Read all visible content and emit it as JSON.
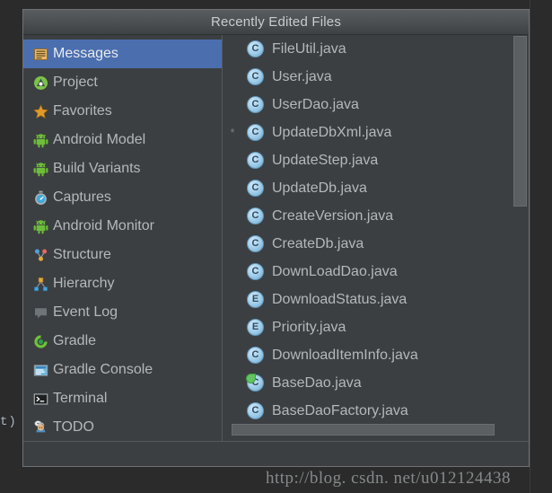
{
  "window": {
    "title": "Recently Edited Files"
  },
  "editor_peek": {
    "text": "t) ",
    "semicolon": ";"
  },
  "watermark": {
    "text": "http://blog. csdn. net/u012124438"
  },
  "sidebar": {
    "items": [
      {
        "label": "Messages",
        "icon": "messages-icon",
        "selected": true
      },
      {
        "label": "Project",
        "icon": "android-studio-icon",
        "selected": false
      },
      {
        "label": "Favorites",
        "icon": "star-icon",
        "selected": false
      },
      {
        "label": "Android Model",
        "icon": "android-robot-icon",
        "selected": false
      },
      {
        "label": "Build Variants",
        "icon": "android-robot-icon",
        "selected": false
      },
      {
        "label": "Captures",
        "icon": "stopwatch-icon",
        "selected": false
      },
      {
        "label": "Android Monitor",
        "icon": "android-robot-icon",
        "selected": false
      },
      {
        "label": "Structure",
        "icon": "structure-nodes-icon",
        "selected": false
      },
      {
        "label": "Hierarchy",
        "icon": "hierarchy-icon",
        "selected": false
      },
      {
        "label": "Event Log",
        "icon": "speech-bubble-icon",
        "selected": false
      },
      {
        "label": "Gradle",
        "icon": "gradle-elephant-icon",
        "selected": false
      },
      {
        "label": "Gradle Console",
        "icon": "console-window-icon",
        "selected": false
      },
      {
        "label": "Terminal",
        "icon": "terminal-prompt-icon",
        "selected": false
      },
      {
        "label": "TODO",
        "icon": "todo-person-icon",
        "selected": false
      }
    ]
  },
  "file_list": {
    "marker_symbol": "*",
    "items": [
      {
        "name": "FileUtil.java",
        "kind": "C",
        "marked": false,
        "vcs": "none"
      },
      {
        "name": "User.java",
        "kind": "C",
        "marked": false,
        "vcs": "none"
      },
      {
        "name": "UserDao.java",
        "kind": "C",
        "marked": false,
        "vcs": "none"
      },
      {
        "name": "UpdateDbXml.java",
        "kind": "C",
        "marked": true,
        "vcs": "none"
      },
      {
        "name": "UpdateStep.java",
        "kind": "C",
        "marked": false,
        "vcs": "none"
      },
      {
        "name": "UpdateDb.java",
        "kind": "C",
        "marked": false,
        "vcs": "none"
      },
      {
        "name": "CreateVersion.java",
        "kind": "C",
        "marked": false,
        "vcs": "none"
      },
      {
        "name": "CreateDb.java",
        "kind": "C",
        "marked": false,
        "vcs": "none"
      },
      {
        "name": "DownLoadDao.java",
        "kind": "C",
        "marked": false,
        "vcs": "none"
      },
      {
        "name": "DownloadStatus.java",
        "kind": "E",
        "marked": false,
        "vcs": "none"
      },
      {
        "name": "Priority.java",
        "kind": "E",
        "marked": false,
        "vcs": "none"
      },
      {
        "name": "DownloadItemInfo.java",
        "kind": "C",
        "marked": false,
        "vcs": "none"
      },
      {
        "name": "BaseDao.java",
        "kind": "C",
        "marked": false,
        "vcs": "new"
      },
      {
        "name": "BaseDaoFactory.java",
        "kind": "C",
        "marked": false,
        "vcs": "none"
      }
    ]
  },
  "colors": {
    "dialog_bg": "#3c3f41",
    "app_bg": "#2b2b2b",
    "selection_blue": "#4b6eaf",
    "text": "#b5b8ba",
    "scrollbar_thumb": "#5c5f61"
  }
}
